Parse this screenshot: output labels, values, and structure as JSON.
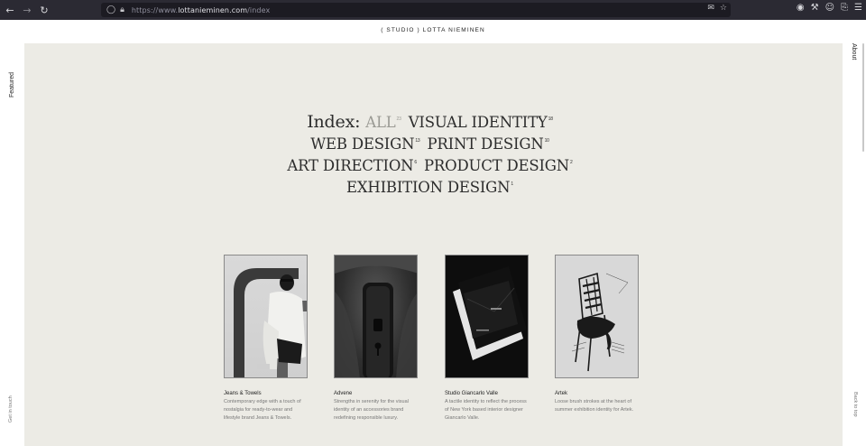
{
  "browser": {
    "url_prefix": "https://www.",
    "url_domain": "lottanieminen.com",
    "url_path": "/index"
  },
  "header": {
    "brand": "( STUDIO )  LOTTA  NIEMINEN"
  },
  "sidebar": {
    "left_top": "Featured",
    "right_top": "About",
    "left_bottom": "Get in touch",
    "right_bottom": "Back to top"
  },
  "index": {
    "label": "Index:",
    "categories": [
      {
        "name": "ALL",
        "count": "23",
        "active": true
      },
      {
        "name": "VISUAL IDENTITY",
        "count": "18",
        "active": false
      },
      {
        "name": "WEB DESIGN",
        "count": "13",
        "active": false
      },
      {
        "name": "PRINT DESIGN",
        "count": "10",
        "active": false
      },
      {
        "name": "ART DIRECTION",
        "count": "6",
        "active": false
      },
      {
        "name": "PRODUCT DESIGN",
        "count": "2",
        "active": false
      },
      {
        "name": "EXHIBITION DESIGN",
        "count": "1",
        "active": false
      }
    ]
  },
  "projects": [
    {
      "title": "Jeans & Towels",
      "description": "Contemporary edge with a touch of nostalgia for ready-to-wear and lifestyle brand Jeans & Towels."
    },
    {
      "title": "Advene",
      "description": "Strengths in serenity for the visual identity of an accessories brand redefining responsible luxury."
    },
    {
      "title": "Studio Giancarlo Valle",
      "description": "A tactile identity to reflect the process of New York based interior designer Giancarlo Valle."
    },
    {
      "title": "Artek",
      "description": "Loose brush strokes at the heart of summer exhibition identity for Artek."
    }
  ]
}
